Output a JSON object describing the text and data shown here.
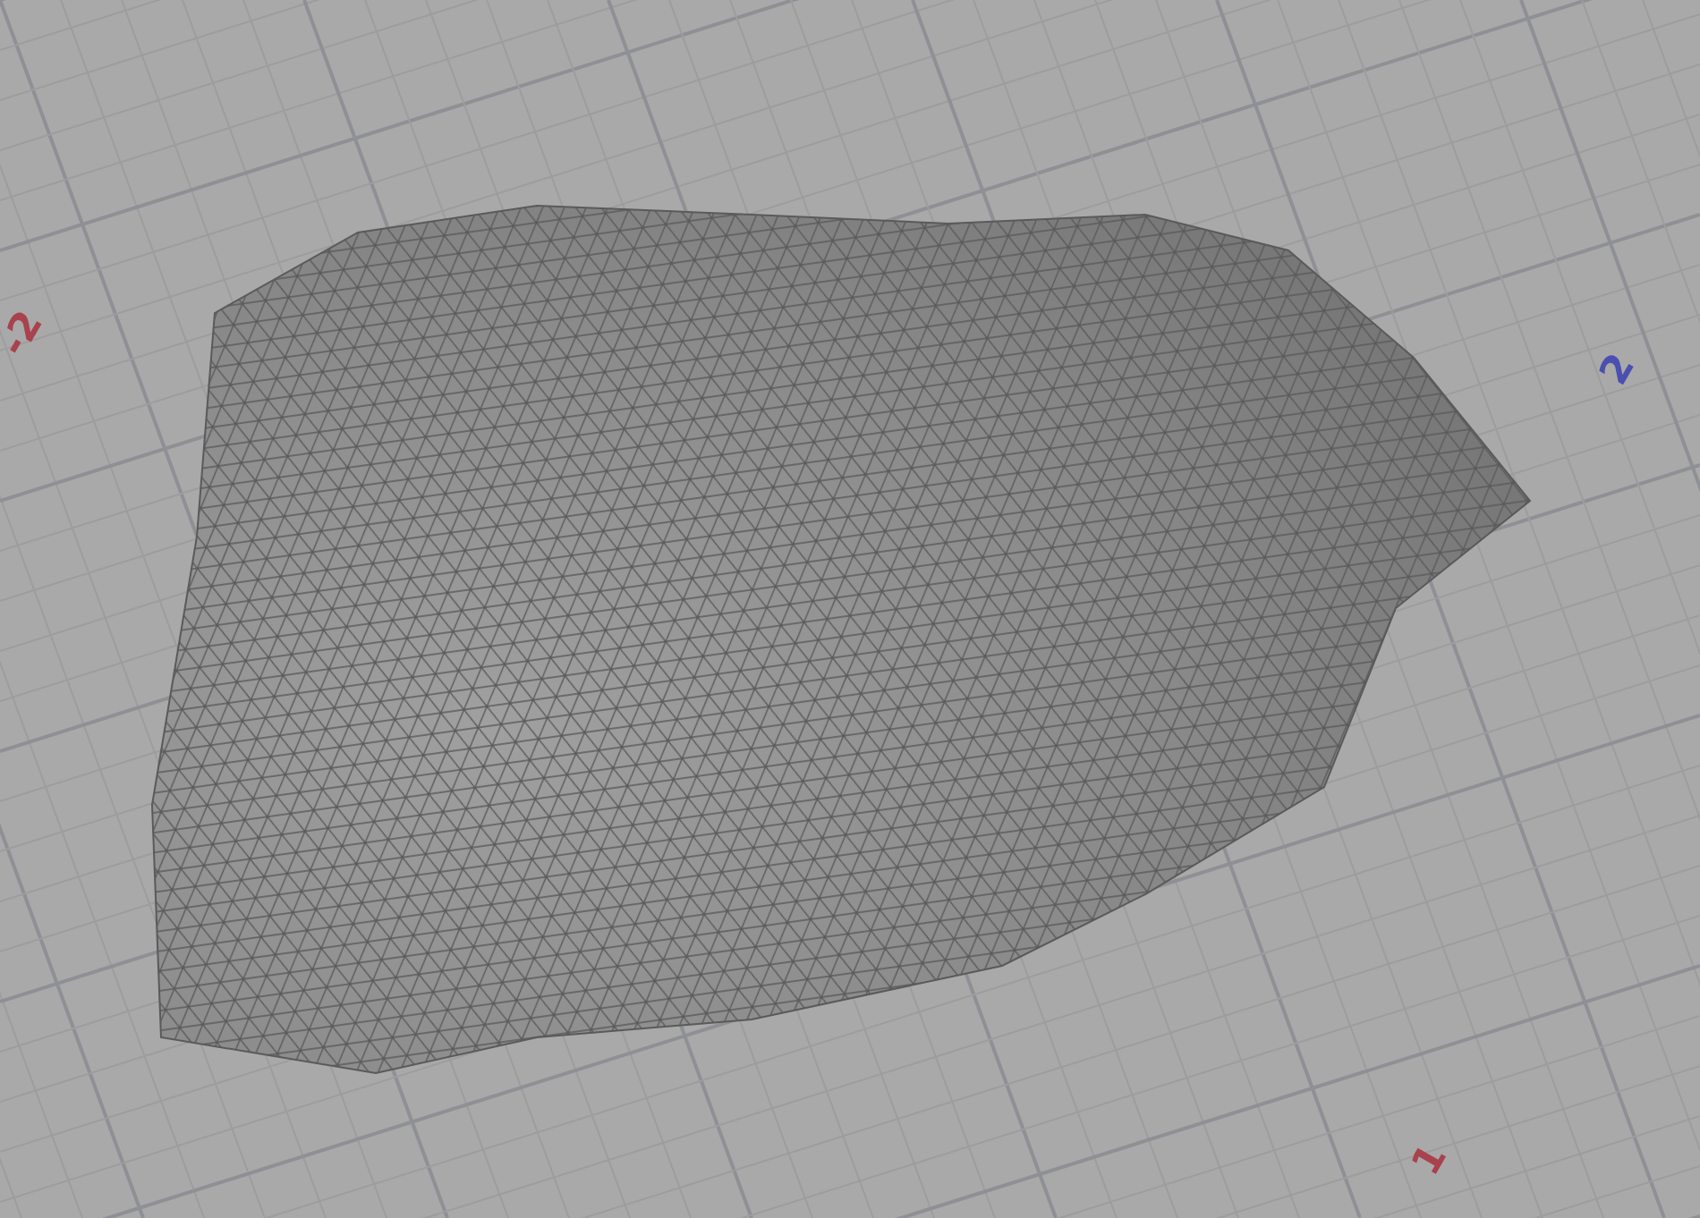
{
  "viewport": {
    "axis_labels": [
      {
        "text": "-2",
        "color": "#a8424c"
      },
      {
        "text": "2",
        "color": "#4a4fb0"
      },
      {
        "text": "1",
        "color": "#a8424c"
      }
    ]
  }
}
